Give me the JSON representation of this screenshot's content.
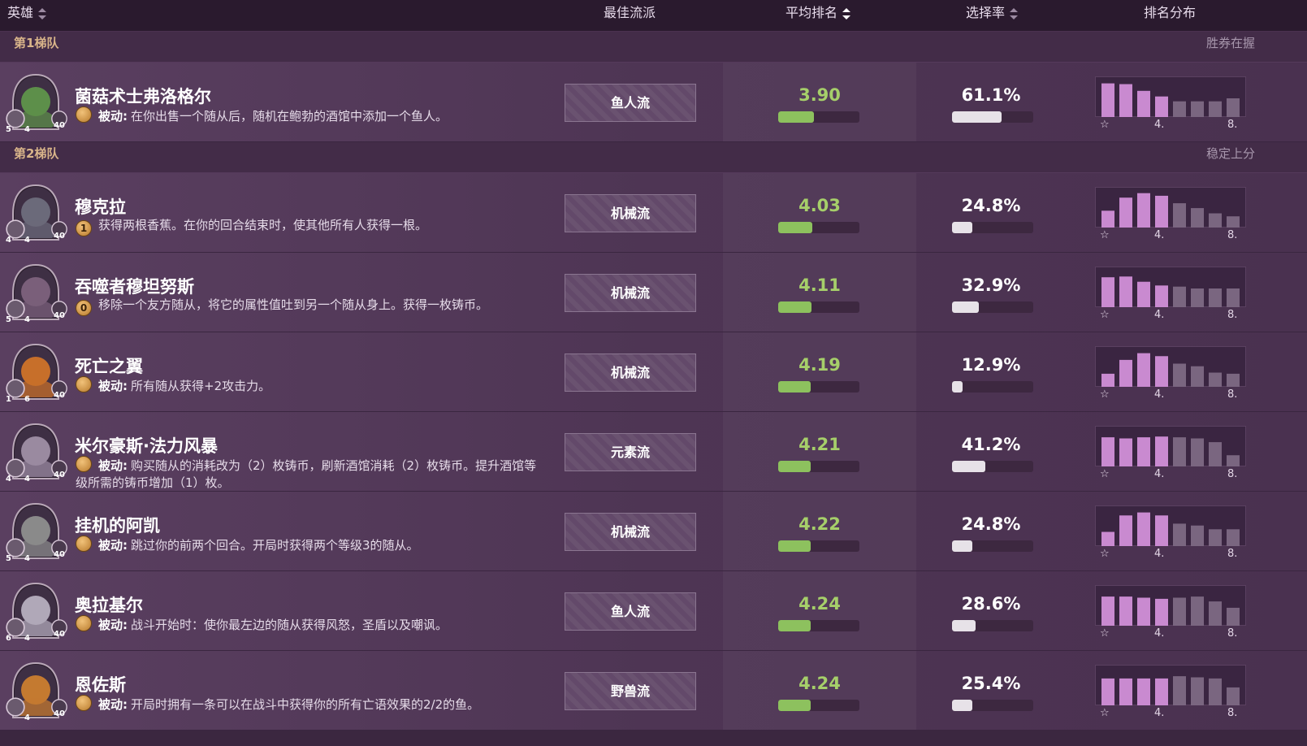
{
  "header": {
    "hero": "英雄",
    "best_comp": "最佳流派",
    "avg_rank": "平均排名",
    "pick_rate": "选择率",
    "rank_dist": "排名分布"
  },
  "dist_labels": {
    "first": "☆",
    "mid": "4.",
    "last": "8."
  },
  "tiers": [
    {
      "name": "第1梯队",
      "desc": "胜券在握"
    },
    {
      "name": "第2梯队",
      "desc": "稳定上分"
    }
  ],
  "heroes": [
    {
      "name": "菌菇术士弗洛格尔",
      "power_prefix": "被动:",
      "power": "在你出售一个随从后，随机在鲍勃的酒馆中添加一个鱼人。",
      "coin": "",
      "comp": "鱼人流",
      "avg_rank": "3.90",
      "rank_value": 3.9,
      "pick": "61.1%",
      "pick_value": 61.1,
      "stats": [
        "5",
        "4",
        "40"
      ],
      "portrait_color": "#5d8f4a",
      "dist": [
        0.9,
        0.88,
        0.7,
        0.55,
        0.42,
        0.42,
        0.42,
        0.5
      ]
    },
    {
      "name": "穆克拉",
      "power_prefix": "",
      "power": "获得两根香蕉。在你的回合结束时，使其他所有人获得一根。",
      "coin": "1",
      "comp": "机械流",
      "avg_rank": "4.03",
      "rank_value": 4.03,
      "pick": "24.8%",
      "pick_value": 24.8,
      "stats": [
        "4",
        "4",
        "40"
      ],
      "portrait_color": "#6b6a7a",
      "dist": [
        0.45,
        0.8,
        0.92,
        0.85,
        0.65,
        0.52,
        0.38,
        0.3
      ]
    },
    {
      "name": "吞噬者穆坦努斯",
      "power_prefix": "",
      "power": "移除一个友方随从，将它的属性值吐到另一个随从身上。获得一枚铸币。",
      "coin": "0",
      "comp": "机械流",
      "avg_rank": "4.11",
      "rank_value": 4.11,
      "pick": "32.9%",
      "pick_value": 32.9,
      "stats": [
        "5",
        "4",
        "40"
      ],
      "portrait_color": "#7a5f7a",
      "dist": [
        0.8,
        0.82,
        0.68,
        0.58,
        0.55,
        0.5,
        0.5,
        0.5
      ]
    },
    {
      "name": "死亡之翼",
      "power_prefix": "被动:",
      "power": "所有随从获得+2攻击力。",
      "coin": "",
      "comp": "机械流",
      "avg_rank": "4.19",
      "rank_value": 4.19,
      "pick": "12.9%",
      "pick_value": 12.9,
      "stats": [
        "1",
        "6",
        "40"
      ],
      "portrait_color": "#c76f2a",
      "dist": [
        0.35,
        0.72,
        0.9,
        0.82,
        0.62,
        0.55,
        0.38,
        0.35
      ]
    },
    {
      "name": "米尔豪斯·法力风暴",
      "power_prefix": "被动:",
      "power": "购买随从的消耗改为（2）枚铸币，刷新酒馆消耗（2）枚铸币。提升酒馆等级所需的铸币增加（1）枚。",
      "coin": "",
      "comp": "元素流",
      "avg_rank": "4.21",
      "rank_value": 4.21,
      "pick": "41.2%",
      "pick_value": 41.2,
      "stats": [
        "4",
        "4",
        "40"
      ],
      "portrait_color": "#9a8aa0",
      "dist": [
        0.78,
        0.75,
        0.78,
        0.8,
        0.78,
        0.75,
        0.65,
        0.3
      ]
    },
    {
      "name": "挂机的阿凯",
      "power_prefix": "被动:",
      "power": "跳过你的前两个回合。开局时获得两个等级3的随从。",
      "coin": "",
      "comp": "机械流",
      "avg_rank": "4.22",
      "rank_value": 4.22,
      "pick": "24.8%",
      "pick_value": 24.8,
      "stats": [
        "5",
        "4",
        "40"
      ],
      "portrait_color": "#8a8a8a",
      "dist": [
        0.38,
        0.82,
        0.9,
        0.82,
        0.6,
        0.55,
        0.45,
        0.45
      ]
    },
    {
      "name": "奥拉基尔",
      "power_prefix": "被动:",
      "power": "战斗开始时：使你最左边的随从获得风怒，圣盾以及嘲讽。",
      "coin": "",
      "comp": "鱼人流",
      "avg_rank": "4.24",
      "rank_value": 4.24,
      "pick": "28.6%",
      "pick_value": 28.6,
      "stats": [
        "6",
        "4",
        "40"
      ],
      "portrait_color": "#b0a8b8",
      "dist": [
        0.78,
        0.78,
        0.75,
        0.72,
        0.75,
        0.78,
        0.65,
        0.48
      ]
    },
    {
      "name": "恩佐斯",
      "power_prefix": "被动:",
      "power": "开局时拥有一条可以在战斗中获得你的所有亡语效果的2/2的鱼。",
      "coin": "",
      "comp": "野兽流",
      "avg_rank": "4.24",
      "rank_value": 4.24,
      "pick": "25.4%",
      "pick_value": 25.4,
      "stats": [
        "",
        "4",
        "40"
      ],
      "portrait_color": "#c47a30",
      "dist": [
        0.72,
        0.72,
        0.72,
        0.72,
        0.78,
        0.75,
        0.72,
        0.48
      ]
    }
  ]
}
